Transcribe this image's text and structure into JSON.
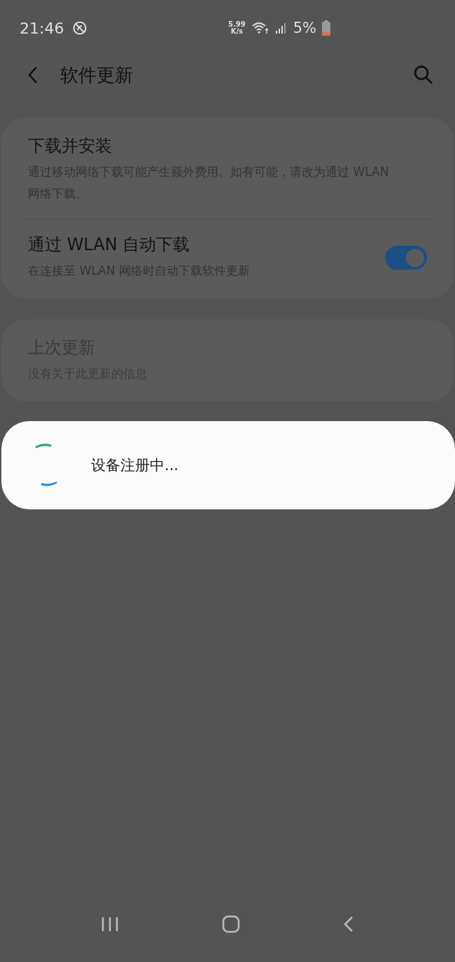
{
  "status_bar": {
    "time": "21:46",
    "speed_value": "5.99",
    "speed_unit": "K/s",
    "battery": "5%"
  },
  "header": {
    "title": "软件更新"
  },
  "groups": [
    {
      "items": [
        {
          "kind": "text",
          "title": "下载并安装",
          "subtitle": "通过移动网络下载可能产生额外费用。如有可能，请改为通过 WLAN 网络下载。",
          "disabled": false
        },
        {
          "kind": "switch",
          "title": "通过 WLAN 自动下载",
          "subtitle": "在连接至 WLAN 网络时自动下载软件更新",
          "disabled": false,
          "on": true
        }
      ]
    },
    {
      "items": [
        {
          "kind": "text",
          "title": "上次更新",
          "subtitle": "没有关于此更新的信息",
          "disabled": true
        }
      ]
    }
  ],
  "dialog": {
    "message": "设备注册中..."
  }
}
